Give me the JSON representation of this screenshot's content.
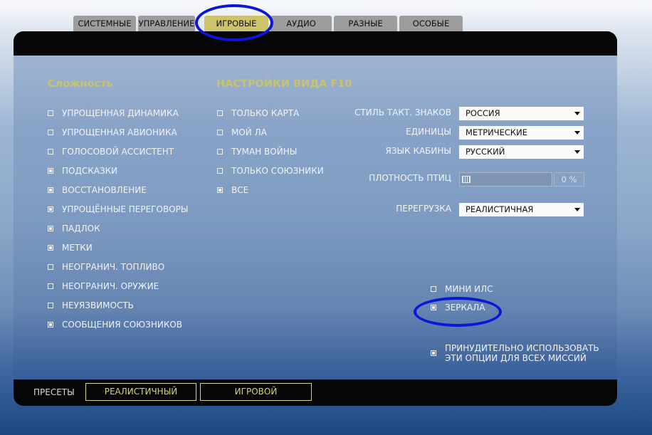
{
  "tabs": [
    "СИСТЕМНЫЕ",
    "УПРАВЛЕНИЕ",
    "ИГРОВЫЕ",
    "АУДИО",
    "РАЗНЫЕ",
    "ОСОБЫЕ"
  ],
  "active_tab": "ИГРОВЫЕ",
  "difficulty": {
    "title": "Сложность",
    "items": [
      {
        "label": "УПРОЩЕННАЯ ДИНАМИКА",
        "checked": false
      },
      {
        "label": "УПРОЩЕННАЯ АВИОНИКА",
        "checked": false
      },
      {
        "label": "ГОЛОСОВОЙ АССИСТЕНТ",
        "checked": false
      },
      {
        "label": "ПОДСКАЗКИ",
        "checked": true
      },
      {
        "label": "ВОССТАНОВЛЕНИЕ",
        "checked": true
      },
      {
        "label": "УПРОЩЁННЫЕ ПЕРЕГОВОРЫ",
        "checked": true
      },
      {
        "label": "ПАДЛОК",
        "checked": true
      },
      {
        "label": "МЕТКИ",
        "checked": true
      },
      {
        "label": "НЕОГРАНИЧ. ТОПЛИВО",
        "checked": false
      },
      {
        "label": "НЕОГРАНИЧ. ОРУЖИЕ",
        "checked": false
      },
      {
        "label": "НЕУЯЗВИМОСТЬ",
        "checked": false
      },
      {
        "label": "СООБЩЕНИЯ СОЮЗНИКОВ",
        "checked": true
      }
    ]
  },
  "f10": {
    "title": "НАСТРОЙКИ ВИДА F10",
    "items": [
      {
        "label": "ТОЛЬКО КАРТА",
        "checked": false
      },
      {
        "label": "МОЙ ЛА",
        "checked": false
      },
      {
        "label": "ТУМАН ВОЙНЫ",
        "checked": false
      },
      {
        "label": "ТОЛЬКО СОЮЗНИКИ",
        "checked": false
      },
      {
        "label": "ВСЕ",
        "checked": true
      }
    ]
  },
  "settings": {
    "tactical_symbols": {
      "label": "СТИЛЬ ТАКТ. ЗНАКОВ",
      "value": "РОССИЯ"
    },
    "units": {
      "label": "ЕДИНИЦЫ",
      "value": "МЕТРИЧЕСКИЕ"
    },
    "cockpit_language": {
      "label": "ЯЗЫК КАБИНЫ",
      "value": "РУССКИЙ"
    },
    "bird_density": {
      "label": "ПЛОТНОСТЬ ПТИЦ",
      "value": "0 %",
      "level_percent": 0
    },
    "g_effects": {
      "label": "ПЕРЕГРУЗКА",
      "value": "РЕАЛИСТИЧНАЯ"
    }
  },
  "extras": [
    {
      "label": "МИНИ ИЛС",
      "checked": false
    },
    {
      "label": "ЗЕРКАЛА",
      "checked": true
    }
  ],
  "force_options": {
    "label_line1": "ПРИНУДИТЕЛЬНО ИСПОЛЬЗОВАТЬ",
    "label_line2": "ЭТИ ОПЦИИ ДЛЯ ВСЕХ МИССИЙ",
    "checked": true
  },
  "presets": {
    "label": "ПРЕСЕТЫ",
    "buttons": [
      "РЕАЛИСТИЧНЫЙ",
      "ИГРОВОЙ"
    ]
  },
  "colors": {
    "accent": "#ccc36a",
    "annotation": "#0b16d8"
  },
  "icons": {
    "dropdown": "chevron-down-icon"
  }
}
